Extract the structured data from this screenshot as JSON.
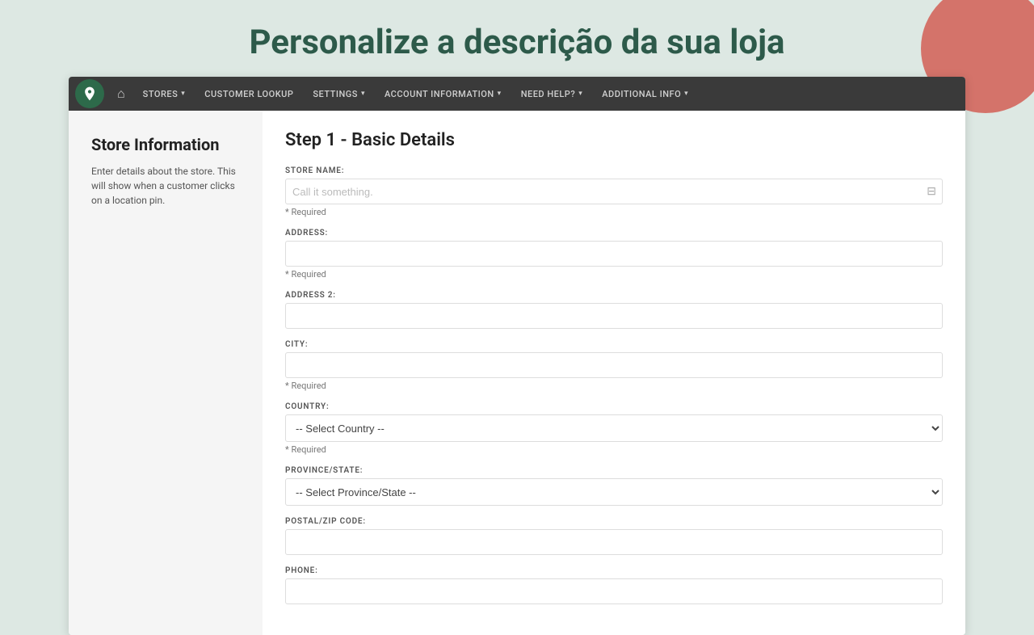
{
  "page": {
    "title": "Personalize a descrição da sua loja"
  },
  "navbar": {
    "items": [
      {
        "label": "Stores",
        "hasDropdown": true
      },
      {
        "label": "Customer Lookup",
        "hasDropdown": false
      },
      {
        "label": "Settings",
        "hasDropdown": true
      },
      {
        "label": "Account Information",
        "hasDropdown": true
      },
      {
        "label": "Need Help?",
        "hasDropdown": true
      },
      {
        "label": "Additional Info",
        "hasDropdown": true
      }
    ]
  },
  "sidebar": {
    "title": "Store Information",
    "description": "Enter details about the store. This will show when a customer clicks on a location pin."
  },
  "form": {
    "step_title": "Step 1 - Basic Details",
    "fields": {
      "store_name": {
        "label": "Store Name:",
        "placeholder": "Call it something.",
        "required": "* Required"
      },
      "address": {
        "label": "Address:",
        "placeholder": "",
        "required": "* Required"
      },
      "address2": {
        "label": "Address 2:",
        "placeholder": "",
        "required": ""
      },
      "city": {
        "label": "City:",
        "placeholder": "",
        "required": "* Required"
      },
      "country": {
        "label": "Country:",
        "default_option": "-- Select Country --",
        "required": "* Required"
      },
      "province": {
        "label": "Province/State:",
        "default_option": "-- Select Province/State --",
        "required": ""
      },
      "postal": {
        "label": "Postal/Zip Code:",
        "placeholder": "",
        "required": ""
      },
      "phone": {
        "label": "Phone:",
        "placeholder": "",
        "required": ""
      }
    }
  }
}
